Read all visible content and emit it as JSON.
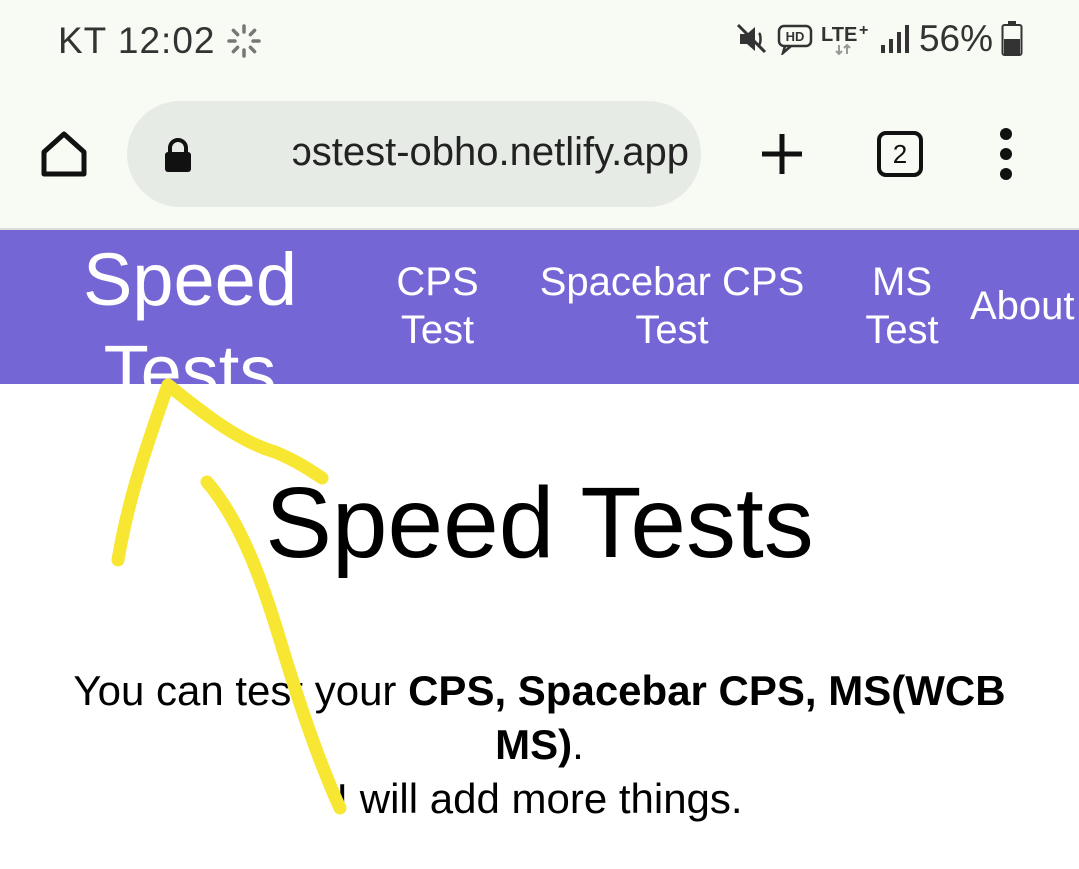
{
  "status_bar": {
    "carrier": "KT",
    "time": "12:02",
    "battery": "56%",
    "icons": [
      "sync-icon",
      "mute-icon",
      "hd-voice-icon",
      "lte-plus-icon",
      "signal-icon",
      "battery-icon"
    ]
  },
  "browser": {
    "url": "ɔstest-obho.netlify.app",
    "tab_count": "2",
    "icons": [
      "home-icon",
      "lock-icon",
      "plus-icon",
      "tabs-icon",
      "more-vert-icon"
    ]
  },
  "nav": {
    "brand": "Speed Tests",
    "links": [
      "CPS Test",
      "Spacebar CPS Test",
      "MS Test",
      "About"
    ]
  },
  "main": {
    "title": "Speed Tests",
    "intro_prefix": "You can test your ",
    "intro_bold": "CPS, Spacebar CPS, MS(WCB MS)",
    "intro_suffix": ".",
    "intro_line2": "I will add more things."
  },
  "colors": {
    "nav_background": "#7566d6",
    "annotation": "#f7e733",
    "browser_chrome": "#f7fbf4",
    "url_box": "#e6ebe5"
  }
}
